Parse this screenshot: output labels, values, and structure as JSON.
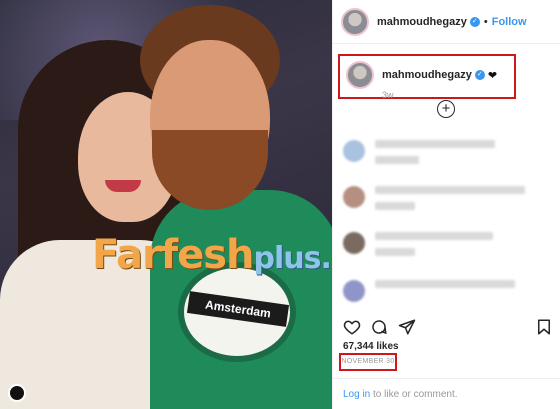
{
  "post": {
    "username": "mahmoudhegazy",
    "follow_label": "Follow",
    "separator": "•",
    "verified_symbol": "✓",
    "caption_heart": "❤",
    "time_ago": "3w",
    "likes": "67,344 likes",
    "date": "NOVEMBER 30",
    "login_link": "Log in",
    "login_suffix": " to like or comment.",
    "load_more_icon": "plus-circle-icon",
    "photo_hoodie_text": "Amsterdam"
  },
  "watermark": {
    "part1": "Farfesh",
    "part2": "plus.com"
  },
  "colors": {
    "link_blue": "#3897f0",
    "highlight_red": "#d0161b",
    "text_dark": "#262626",
    "text_muted": "#999999"
  },
  "icons": [
    "heart-icon",
    "comment-icon",
    "share-icon",
    "bookmark-icon",
    "verified-badge-icon"
  ]
}
